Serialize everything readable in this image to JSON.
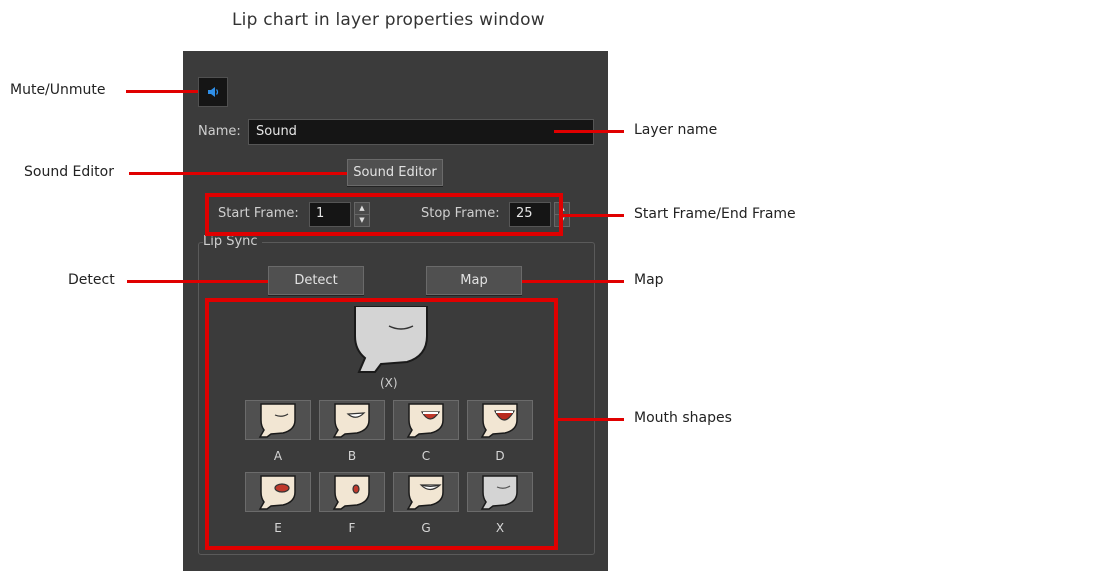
{
  "caption": "Lip chart in layer properties window",
  "annotations": {
    "mute": "Mute/Unmute",
    "layer_name": "Layer name",
    "sound_editor": "Sound Editor",
    "frames": "Start Frame/End Frame",
    "detect": "Detect",
    "map": "Map",
    "mouth_shapes": "Mouth shapes"
  },
  "panel": {
    "name_label": "Name:",
    "name_value": "Sound",
    "sound_editor_button": "Sound Editor",
    "start_frame_label": "Start Frame:",
    "start_frame_value": "1",
    "stop_frame_label": "Stop Frame:",
    "stop_frame_value": "25",
    "lip_sync_group": "Lip Sync",
    "detect_button": "Detect",
    "map_button": "Map",
    "preview_label": "(X)",
    "mouth_shapes": [
      {
        "label": "A",
        "icon": "mouth-a-icon"
      },
      {
        "label": "B",
        "icon": "mouth-b-icon"
      },
      {
        "label": "C",
        "icon": "mouth-c-icon"
      },
      {
        "label": "D",
        "icon": "mouth-d-icon"
      },
      {
        "label": "E",
        "icon": "mouth-e-icon"
      },
      {
        "label": "F",
        "icon": "mouth-f-icon"
      },
      {
        "label": "G",
        "icon": "mouth-g-icon"
      },
      {
        "label": "X",
        "icon": "mouth-x-icon"
      }
    ]
  },
  "colors": {
    "panel_bg": "#3b3b3b",
    "annotation_red": "#e00000",
    "face_skin": "#f2e6d3",
    "face_grey": "#d4d4d4"
  }
}
